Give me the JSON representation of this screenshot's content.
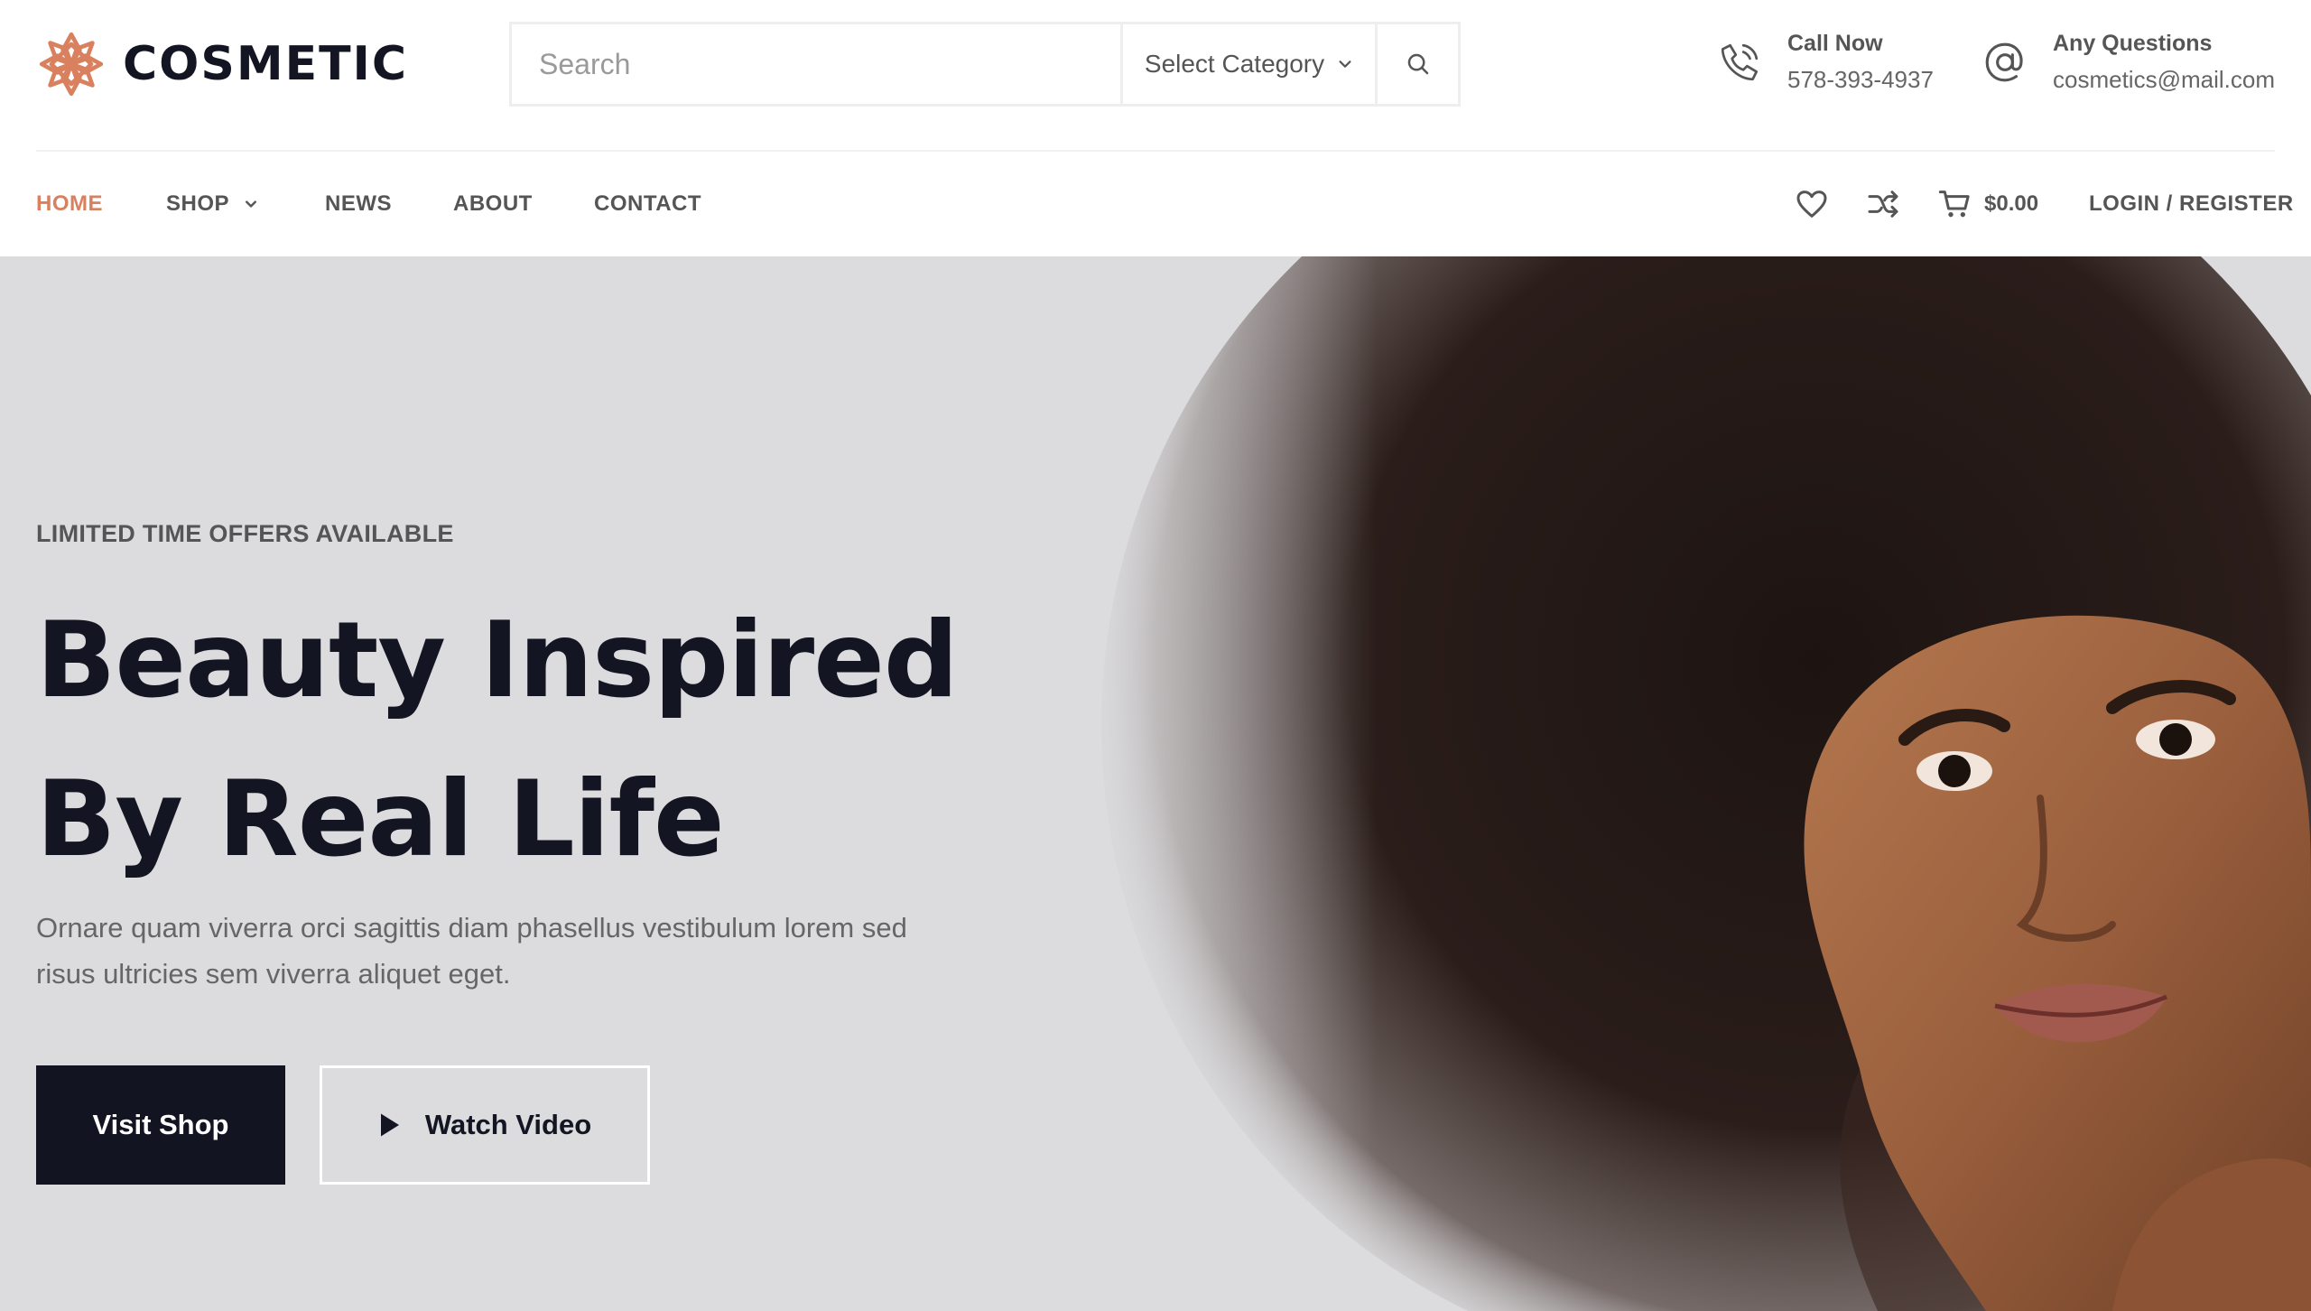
{
  "brand": {
    "name": "COSMETIC",
    "accent_color": "#d9805f",
    "icon": "flower-logo-icon"
  },
  "search": {
    "placeholder": "Search",
    "category_label": "Select Category"
  },
  "contact": {
    "call": {
      "title": "Call Now",
      "value": "578-393-4937",
      "icon": "phone-icon"
    },
    "mail": {
      "title": "Any Questions",
      "value": "cosmetics@mail.com",
      "icon": "at-sign-icon"
    }
  },
  "nav": {
    "items": [
      {
        "label": "HOME",
        "active": true
      },
      {
        "label": "SHOP",
        "has_dropdown": true
      },
      {
        "label": "NEWS"
      },
      {
        "label": "ABOUT"
      },
      {
        "label": "CONTACT"
      }
    ],
    "cart_total": "$0.00",
    "login_label": "LOGIN / REGISTER"
  },
  "hero": {
    "eyebrow": "LIMITED TIME OFFERS AVAILABLE",
    "title_line1": "Beauty Inspired",
    "title_line2": "By Real Life",
    "description": "Ornare quam viverra orci sagittis diam phasellus vestibulum lorem sed risus ultricies sem viverra aliquet eget.",
    "primary_button": "Visit Shop",
    "secondary_button": "Watch Video",
    "background_color": "#dcdcde"
  }
}
